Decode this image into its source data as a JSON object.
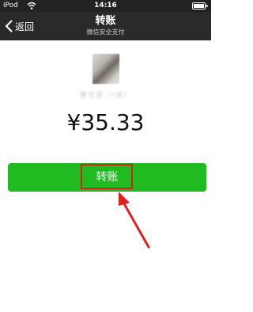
{
  "status_bar": {
    "carrier": "iPod",
    "time": "14:16"
  },
  "nav": {
    "back_label": "返回",
    "title": "转账",
    "subtitle": "微信安全支付"
  },
  "payee": {
    "name": "曹文清（*波）"
  },
  "amount": "¥35.33",
  "transfer_button": {
    "label": "转账",
    "color": "#1fbb21"
  },
  "annotation": {
    "highlight_color": "#d71f1f",
    "arrow_color": "#e02020"
  }
}
